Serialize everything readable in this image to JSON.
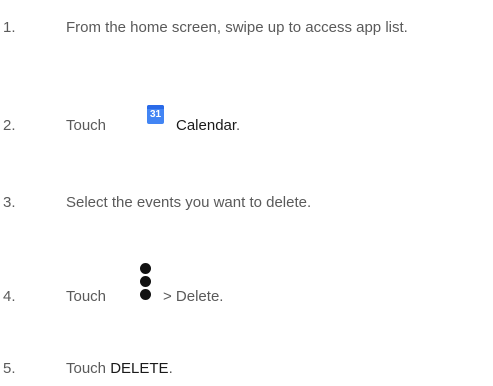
{
  "steps": [
    {
      "number": "1.",
      "text": "From the home screen, swipe up to access app list."
    },
    {
      "number": "2.",
      "text": "Touch",
      "icon": "calendar-app-icon",
      "icon_text": "31",
      "app_name": "Calendar",
      "suffix": "."
    },
    {
      "number": "3.",
      "text": "Select the events you want to delete."
    },
    {
      "number": "4.",
      "text": "Touch",
      "icon": "more-options-icon",
      "after_icon": "> Delete."
    },
    {
      "number": "5.",
      "text": "Touch",
      "button_name": "DELETE",
      "suffix": "."
    }
  ],
  "colors": {
    "text": "#5a5a5a",
    "emphasis": "#1a1a1a",
    "calendar_blue": "#4285f4",
    "dots": "#111111"
  }
}
